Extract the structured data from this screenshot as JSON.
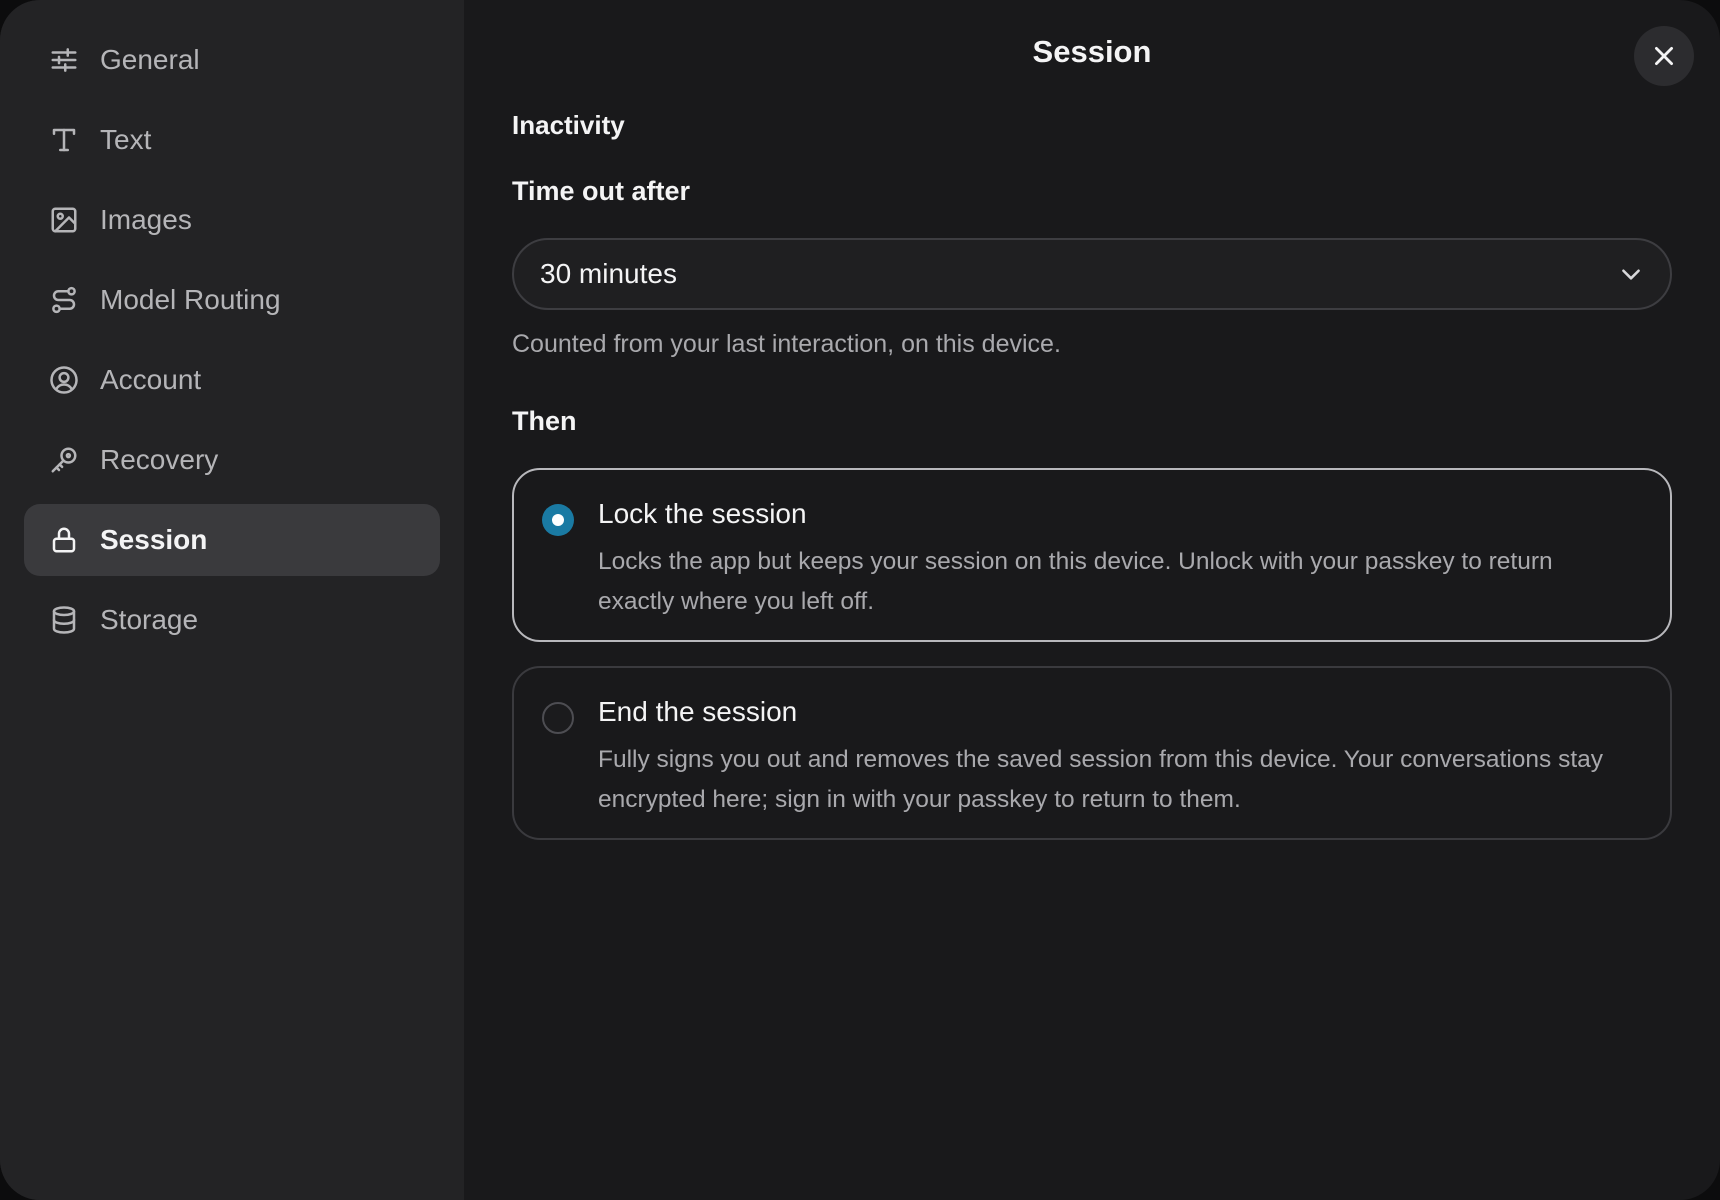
{
  "sidebar": {
    "items": [
      {
        "label": "General",
        "icon": "sliders-icon",
        "active": false
      },
      {
        "label": "Text",
        "icon": "text-icon",
        "active": false
      },
      {
        "label": "Images",
        "icon": "image-icon",
        "active": false
      },
      {
        "label": "Model Routing",
        "icon": "route-icon",
        "active": false
      },
      {
        "label": "Account",
        "icon": "user-circle-icon",
        "active": false
      },
      {
        "label": "Recovery",
        "icon": "key-icon",
        "active": false
      },
      {
        "label": "Session",
        "icon": "lock-icon",
        "active": true
      },
      {
        "label": "Storage",
        "icon": "database-icon",
        "active": false
      }
    ]
  },
  "header": {
    "title": "Session",
    "close_icon": "close-icon"
  },
  "main": {
    "section_title": "Inactivity",
    "timeout": {
      "label": "Time out after",
      "value": "30 minutes",
      "helper": "Counted from your last interaction, on this device."
    },
    "then_label": "Then",
    "options": [
      {
        "title": "Lock the session",
        "description": "Locks the app but keeps your session on this device. Unlock with your passkey to return exactly where you left off.",
        "selected": true
      },
      {
        "title": "End the session",
        "description": "Fully signs you out and removes the saved session from this device. Your conversations stay encrypted here; sign in with your passkey to return to them.",
        "selected": false
      }
    ]
  },
  "colors": {
    "background": "#19191b",
    "sidebar": "#232325",
    "active_item": "#3a3a3d",
    "accent": "#1a7aa3"
  }
}
